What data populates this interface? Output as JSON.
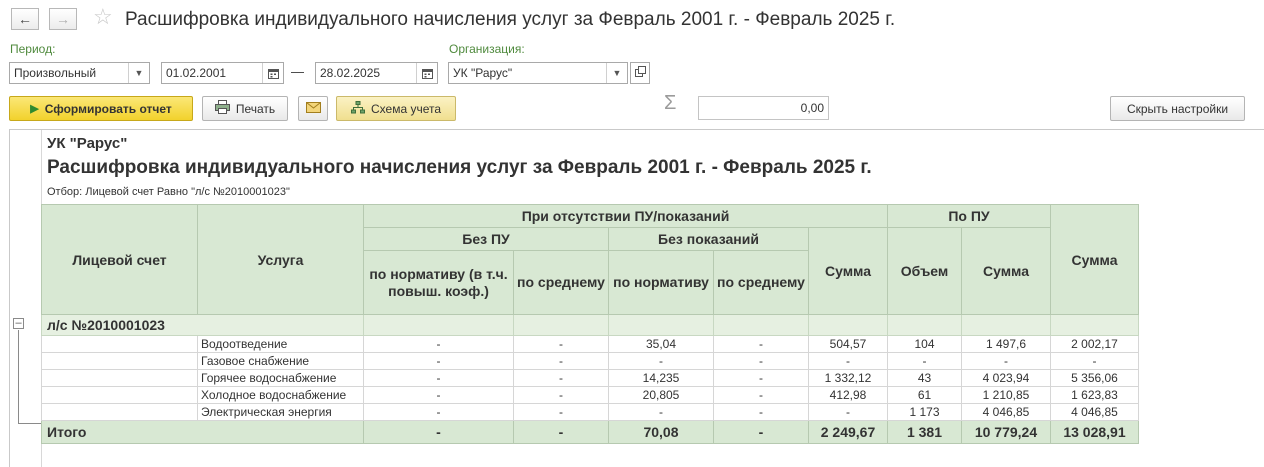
{
  "window": {
    "title": "Расшифровка индивидуального начисления услуг за Февраль 2001 г. - Февраль 2025 г."
  },
  "params": {
    "period_label": "Период:",
    "period_type": "Произвольный",
    "date_from": "01.02.2001",
    "date_separator": "—",
    "date_to": "28.02.2025",
    "org_label": "Организация:",
    "org_value": "УК \"Рарус\""
  },
  "toolbar": {
    "generate_label": "Сформировать отчет",
    "print_label": "Печать",
    "scheme_label": "Схема учета",
    "sigma": "Σ",
    "sum_value": "0,00",
    "hide_settings_label": "Скрыть настройки"
  },
  "report": {
    "org": "УК \"Рарус\"",
    "title": "Расшифровка индивидуального начисления услуг за Февраль 2001 г. - Февраль 2025 г.",
    "filter": "Отбор: Лицевой счет Равно \"л/с №2010001023\"",
    "headers": {
      "account": "Лицевой счет",
      "service": "Услуга",
      "no_meters": "При отсутствии ПУ/показаний",
      "no_pu": "Без ПУ",
      "no_readings": "Без показаний",
      "norm_with_coef": "по нормативу (в т.ч. повыш. коэф.)",
      "avg": "по среднему",
      "norm": "по нормативу",
      "avg2": "по среднему",
      "sum": "Сумма",
      "by_pu": "По ПУ",
      "volume": "Объем",
      "pu_sum": "Сумма",
      "total_sum": "Сумма"
    },
    "group": "л/с №2010001023",
    "rows": [
      {
        "service": "Водоотведение",
        "norm_coef": "-",
        "avg": "-",
        "norm": "35,04",
        "avg2": "-",
        "sum": "504,57",
        "volume": "104",
        "pu_sum": "1 497,6",
        "total": "2 002,17"
      },
      {
        "service": "Газовое снабжение",
        "norm_coef": "-",
        "avg": "-",
        "norm": "-",
        "avg2": "-",
        "sum": "-",
        "volume": "-",
        "pu_sum": "-",
        "total": "-"
      },
      {
        "service": "Горячее водоснабжение",
        "norm_coef": "-",
        "avg": "-",
        "norm": "14,235",
        "avg2": "-",
        "sum": "1 332,12",
        "volume": "43",
        "pu_sum": "4 023,94",
        "total": "5 356,06"
      },
      {
        "service": "Холодное водоснабжение",
        "norm_coef": "-",
        "avg": "-",
        "norm": "20,805",
        "avg2": "-",
        "sum": "412,98",
        "volume": "61",
        "pu_sum": "1 210,85",
        "total": "1 623,83"
      },
      {
        "service": "Электрическая энергия",
        "norm_coef": "-",
        "avg": "-",
        "norm": "-",
        "avg2": "-",
        "sum": "-",
        "volume": "1 173",
        "pu_sum": "4 046,85",
        "total": "4 046,85"
      }
    ],
    "total": {
      "label": "Итого",
      "norm_coef": "-",
      "avg": "-",
      "norm": "70,08",
      "avg2": "-",
      "sum": "2 249,67",
      "volume": "1 381",
      "pu_sum": "10 779,24",
      "total": "13 028,91"
    }
  },
  "colors": {
    "header_bg": "#d8e8d3",
    "label_green": "#4f8a3d",
    "primary_button": "#f2d22c"
  },
  "icons": {
    "back": "arrow-left",
    "forward": "arrow-right",
    "favorite": "star",
    "calendar": "calendar",
    "dropdown": "triangle-down",
    "open": "open-form",
    "print": "printer",
    "email": "envelope",
    "scheme": "scheme-tree",
    "tree_toggle": "minus-box"
  }
}
